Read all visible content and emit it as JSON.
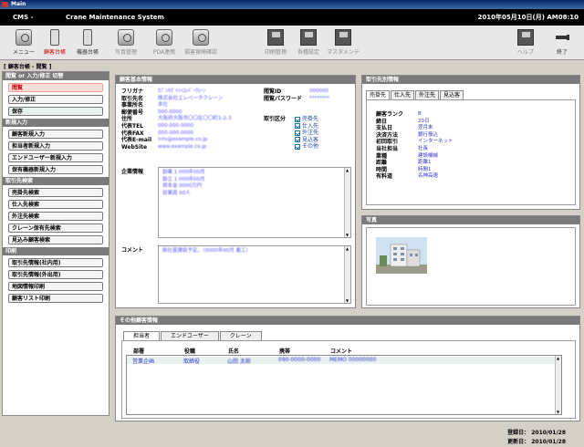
{
  "window": {
    "title": "Main"
  },
  "header": {
    "system": "CMS -",
    "name": "Crane Maintenance System",
    "datetime": "2010年05月10日(月) AM08:10"
  },
  "toolbar": {
    "menu": "メニュー",
    "customer": "顧客台帳",
    "equipment": "機器台帳",
    "photo": "写真管理",
    "pda": "PDA連携",
    "insurance": "損害保険確認",
    "print": "印刷管理",
    "settings": "各種設定",
    "master": "マスタメンテ",
    "help": "ヘルプ",
    "exit": "終了"
  },
  "breadcrumb": "[ 顧客台帳 - 閲覧 ]",
  "sidebar": {
    "sec_mode": "閲覧 or 入力/修正 切替",
    "view": "閲覧",
    "edit": "入力/修正",
    "save": "保存",
    "sec_new": "新規入力",
    "new_customer": "顧客新規入力",
    "new_manager": "担当者新規入力",
    "new_enduser": "エンドユーザー新規入力",
    "new_equipment": "保有機器新規入力",
    "sec_search": "取引先検索",
    "search_sell": "売掛先検索",
    "search_buy": "仕入先検索",
    "search_outsource": "外注先検索",
    "search_crane": "クレーン保有先検索",
    "search_prospect": "見込み顧客検索",
    "sec_print": "印刷",
    "print_internal": "取引先情報(社内用)",
    "print_external": "取引先情報(外出用)",
    "print_map": "地図情報印刷",
    "print_list": "顧客リスト印刷"
  },
  "basic": {
    "title": "顧客基本情報",
    "labels": [
      "フリガナ",
      "取引先名",
      "事業所名",
      "郵便番号",
      "住所",
      "代表TEL",
      "代表FAX",
      "代表E-mail",
      "WebSite"
    ],
    "values": [
      "ｶﾌﾞｼｷｶﾞｲｼｬｴﾚﾊﾞｰｸﾚｰﾝ",
      "株式会社エレベータクレーン",
      "本社",
      "000-0000",
      "大阪府大阪市〇〇区〇〇町1-2-3",
      "000-000-0000",
      "000-000-0000",
      "info@example.co.jp",
      "www.example.co.jp"
    ],
    "login_id_label": "閲覧ID",
    "login_pw_label": "閲覧パスワード",
    "login_id": "000000",
    "login_pw": "********",
    "type_label": "取引区分",
    "types": [
      "売掛先",
      "仕入先",
      "外注先",
      "見込客",
      "その他"
    ],
    "company_label": "企業情報",
    "company_lines": [
      "創業 1 000年00月",
      "設立 1 000年00月",
      "資本金 0000万円",
      "従業員 00人"
    ],
    "comment_label": "コメント",
    "comment": "新社屋建設予定。（0000年00月 着工）"
  },
  "partner": {
    "title": "取引先別情報",
    "tabs": [
      "売掛先",
      "仕入先",
      "外注先",
      "見込客"
    ],
    "labels": [
      "顧客ランク",
      "締日",
      "支払日",
      "決済方法",
      "初回取引",
      "当社担当",
      "業種",
      "距離",
      "時間",
      "有料道"
    ],
    "values": [
      "B",
      "20日",
      "翌月末",
      "銀行振込",
      "インターネット",
      "社長",
      "建設機械",
      "距離1",
      "時間1",
      "名神高速"
    ]
  },
  "photo": {
    "title": "写真"
  },
  "other": {
    "title": "その他顧客情報",
    "tabs": [
      "担当者",
      "エンドユーザー",
      "クレーン"
    ],
    "columns": [
      "部署",
      "役職",
      "氏名",
      "携帯",
      "コメント"
    ],
    "row": [
      "営業企画",
      "取締役",
      "山田 太郎",
      "090-0000-0000",
      "MEMO 00000000"
    ]
  },
  "footer": {
    "registered": "登録日：  2010/01/28",
    "updated": "更新日：  2010/01/28"
  }
}
